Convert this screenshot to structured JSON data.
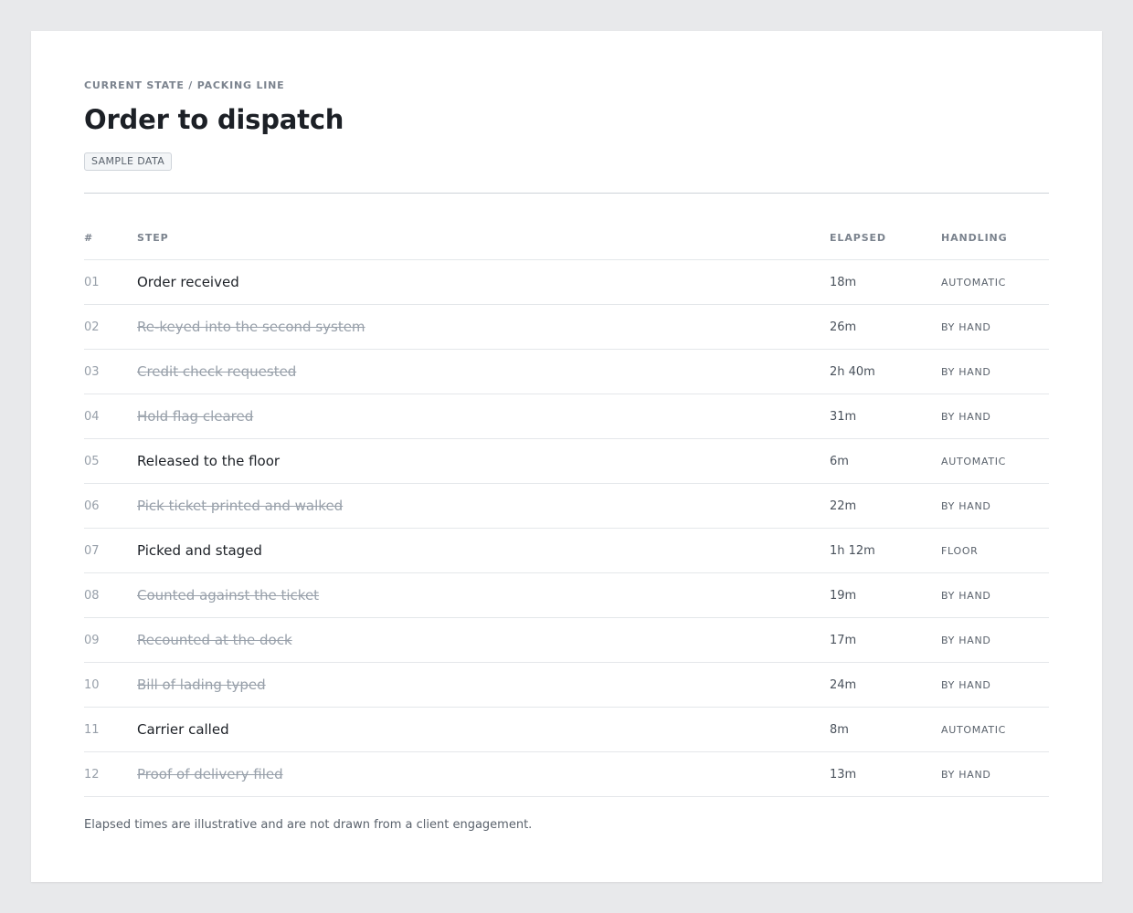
{
  "header": {
    "eyebrow": "CURRENT STATE / PACKING LINE",
    "title": "Order to dispatch",
    "badge": "SAMPLE DATA"
  },
  "table": {
    "columns": {
      "num": "#",
      "step": "STEP",
      "elapsed": "ELAPSED",
      "handling": "HANDLING"
    },
    "rows": [
      {
        "num": "01",
        "step": "Order received",
        "elapsed": "18m",
        "handling": "AUTOMATIC",
        "struck": false
      },
      {
        "num": "02",
        "step": "Re-keyed into the second system",
        "elapsed": "26m",
        "handling": "BY HAND",
        "struck": true
      },
      {
        "num": "03",
        "step": "Credit check requested",
        "elapsed": "2h 40m",
        "handling": "BY HAND",
        "struck": true
      },
      {
        "num": "04",
        "step": "Hold flag cleared",
        "elapsed": "31m",
        "handling": "BY HAND",
        "struck": true
      },
      {
        "num": "05",
        "step": "Released to the floor",
        "elapsed": "6m",
        "handling": "AUTOMATIC",
        "struck": false
      },
      {
        "num": "06",
        "step": "Pick ticket printed and walked",
        "elapsed": "22m",
        "handling": "BY HAND",
        "struck": true
      },
      {
        "num": "07",
        "step": "Picked and staged",
        "elapsed": "1h 12m",
        "handling": "FLOOR",
        "struck": false
      },
      {
        "num": "08",
        "step": "Counted against the ticket",
        "elapsed": "19m",
        "handling": "BY HAND",
        "struck": true
      },
      {
        "num": "09",
        "step": "Recounted at the dock",
        "elapsed": "17m",
        "handling": "BY HAND",
        "struck": true
      },
      {
        "num": "10",
        "step": "Bill of lading typed",
        "elapsed": "24m",
        "handling": "BY HAND",
        "struck": true
      },
      {
        "num": "11",
        "step": "Carrier called",
        "elapsed": "8m",
        "handling": "AUTOMATIC",
        "struck": false
      },
      {
        "num": "12",
        "step": "Proof of delivery filed",
        "elapsed": "13m",
        "handling": "BY HAND",
        "struck": true
      }
    ]
  },
  "footnote": "Elapsed times are illustrative and are not drawn from a client engagement."
}
